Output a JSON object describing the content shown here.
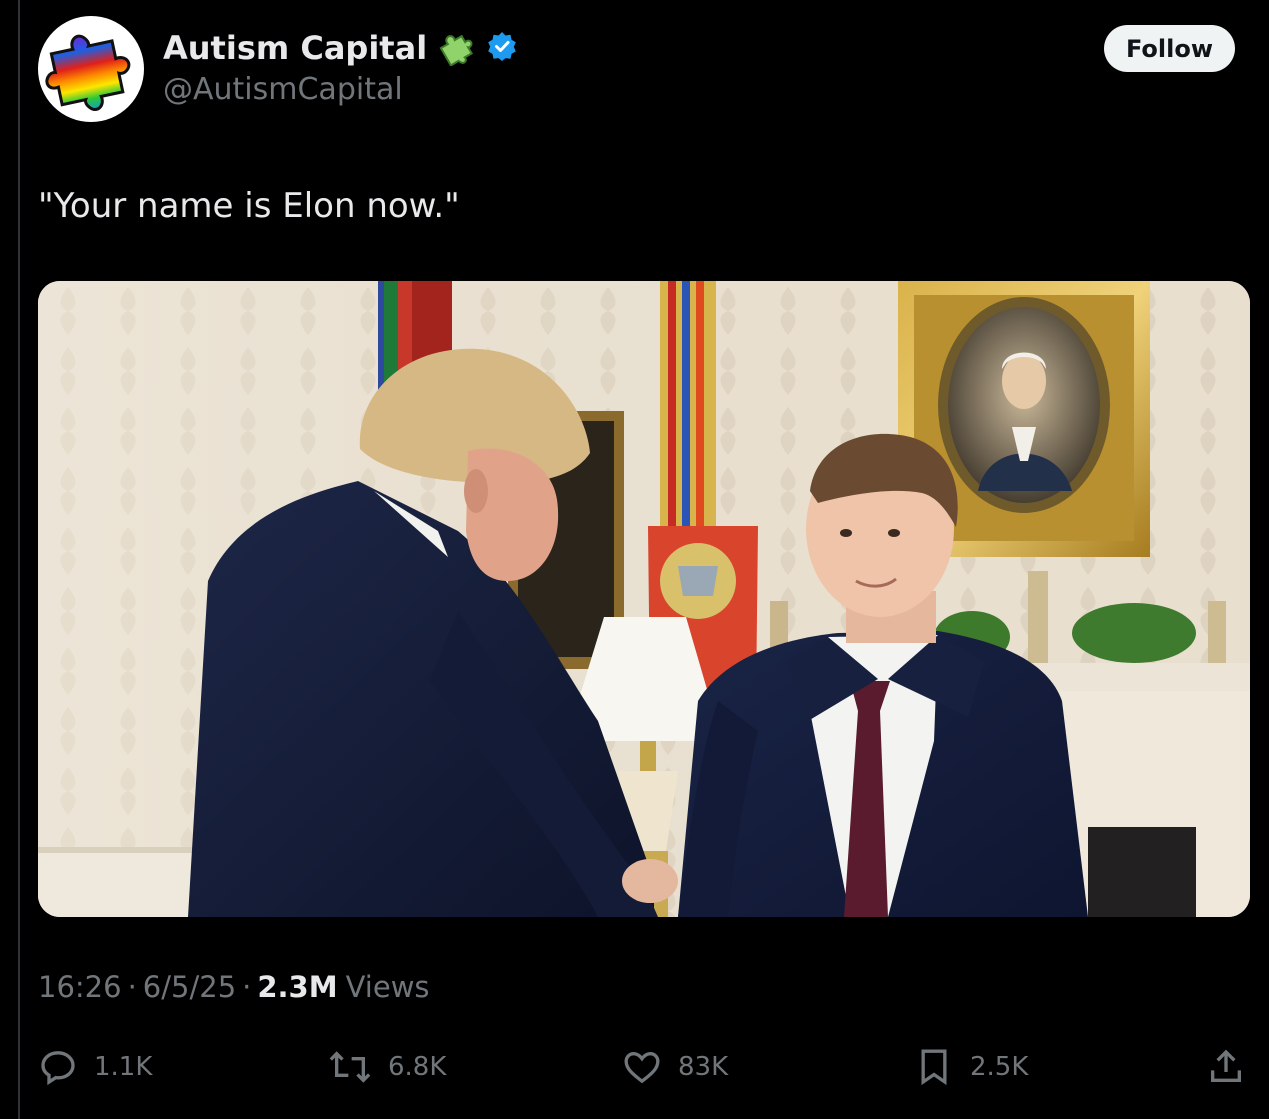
{
  "author": {
    "display_name": "Autism Capital",
    "handle": "@AutismCapital",
    "verified": true,
    "puzzle_emoji_icon": "puzzle-piece-icon",
    "avatar_icon": "rainbow-puzzle-piece-icon"
  },
  "header": {
    "follow_label": "Follow"
  },
  "tweet": {
    "text": "\"Your name is Elon now.\"",
    "image_description_hidden": ""
  },
  "meta": {
    "time": "16:26",
    "sep1": "·",
    "date": "6/5/25",
    "sep2": "·",
    "views_count": "2.3M",
    "views_label": "Views"
  },
  "actions": {
    "replies": "1.1K",
    "reposts": "6.8K",
    "likes": "83K",
    "bookmarks": "2.5K"
  },
  "colors": {
    "background": "#000000",
    "text": "#e7e9ea",
    "muted": "#71767b",
    "verified": "#1d9bf0",
    "follow_bg": "#eff3f4"
  }
}
